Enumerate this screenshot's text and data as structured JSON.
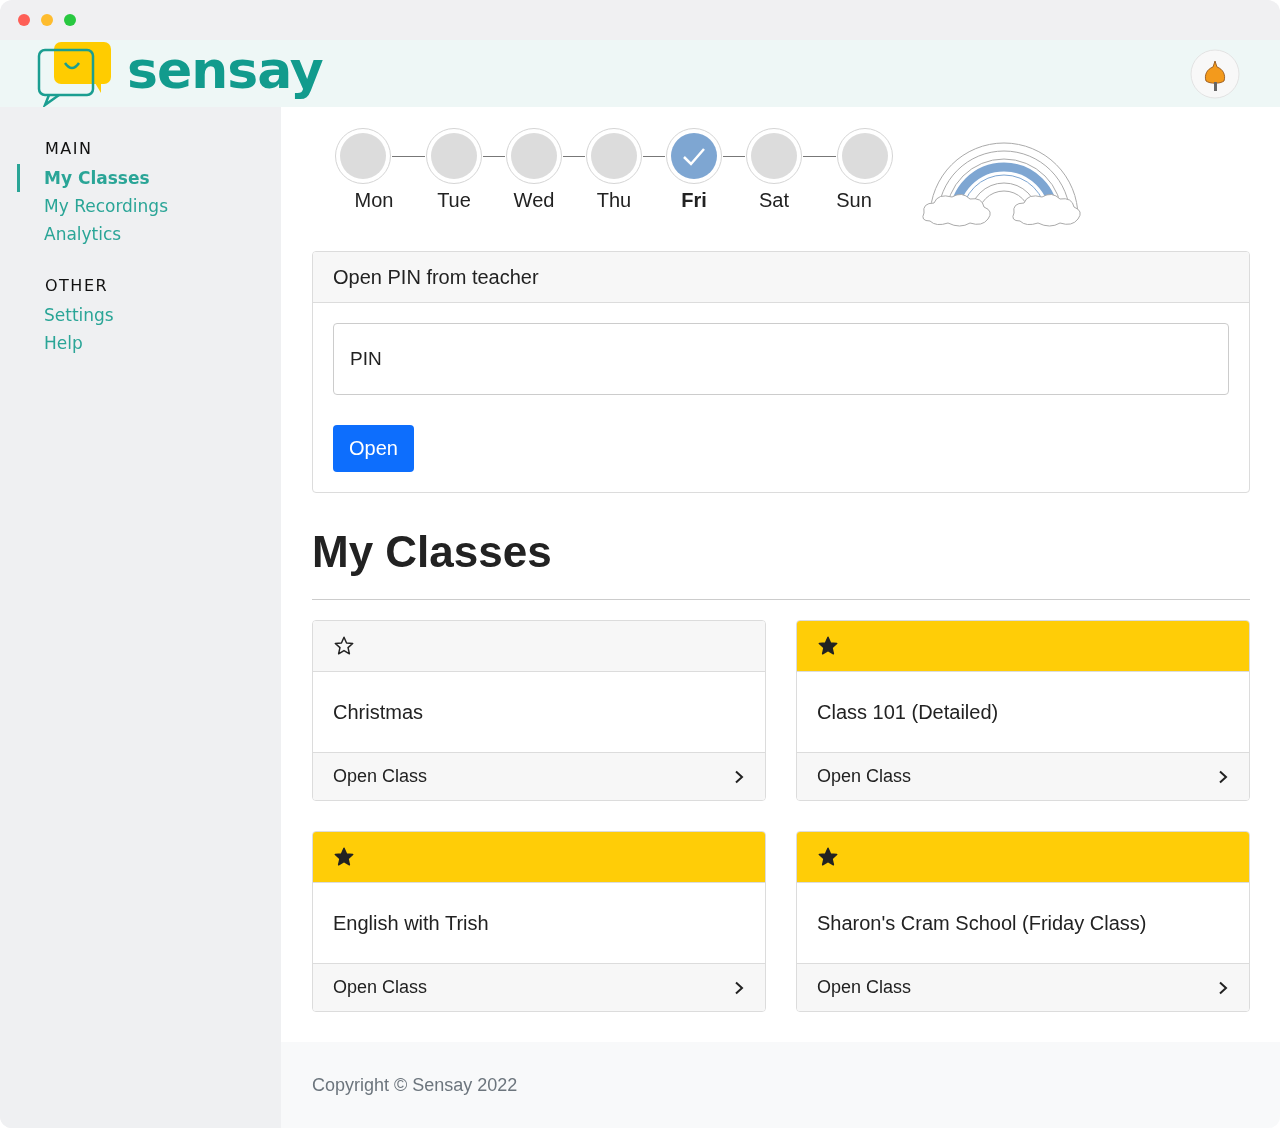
{
  "logo": {
    "text": "sensay"
  },
  "sidebar": {
    "sections": [
      {
        "heading": "MAIN",
        "items": [
          {
            "label": "My Classes",
            "selected": true
          },
          {
            "label": "My Recordings",
            "selected": false
          },
          {
            "label": "Analytics",
            "selected": false
          }
        ]
      },
      {
        "heading": "OTHER",
        "items": [
          {
            "label": "Settings",
            "selected": false
          },
          {
            "label": "Help",
            "selected": false
          }
        ]
      }
    ]
  },
  "week": [
    {
      "day": "Mon",
      "checked": false
    },
    {
      "day": "Tue",
      "checked": false
    },
    {
      "day": "Wed",
      "checked": false
    },
    {
      "day": "Thu",
      "checked": false
    },
    {
      "day": "Fri",
      "checked": true
    },
    {
      "day": "Sat",
      "checked": false
    },
    {
      "day": "Sun",
      "checked": false
    }
  ],
  "pin_card": {
    "title": "Open PIN from teacher",
    "placeholder": "PIN",
    "button": "Open"
  },
  "heading": "My Classes",
  "classes": [
    {
      "name": "Christmas",
      "starred": false,
      "action": "Open Class"
    },
    {
      "name": "Class 101 (Detailed)",
      "starred": true,
      "action": "Open Class"
    },
    {
      "name": "English with Trish",
      "starred": true,
      "action": "Open Class"
    },
    {
      "name": "Sharon's Cram School (Friday Class)",
      "starred": true,
      "action": "Open Class"
    }
  ],
  "footer": "Copyright © Sensay 2022"
}
